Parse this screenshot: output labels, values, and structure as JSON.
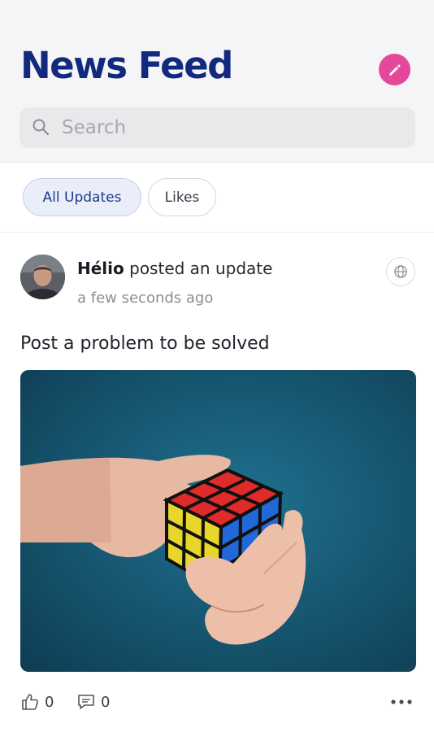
{
  "header": {
    "title": "News Feed",
    "compose_icon": "pencil-icon",
    "compose_color": "#e4489a"
  },
  "search": {
    "placeholder": "Search",
    "value": ""
  },
  "tabs": [
    {
      "label": "All Updates",
      "selected": true
    },
    {
      "label": "Likes",
      "selected": false
    }
  ],
  "post": {
    "author": "Hélio",
    "action_text": "posted an update",
    "time": "a few seconds ago",
    "text": "Post a problem to be solved",
    "privacy_icon": "globe-icon",
    "image_subject": "hands-solving-rubiks-cube",
    "likes_count": "0",
    "comments_count": "0"
  },
  "colors": {
    "title": "#122a7e",
    "accent": "#e4489a",
    "tab_selected_bg": "#e9eef9"
  }
}
